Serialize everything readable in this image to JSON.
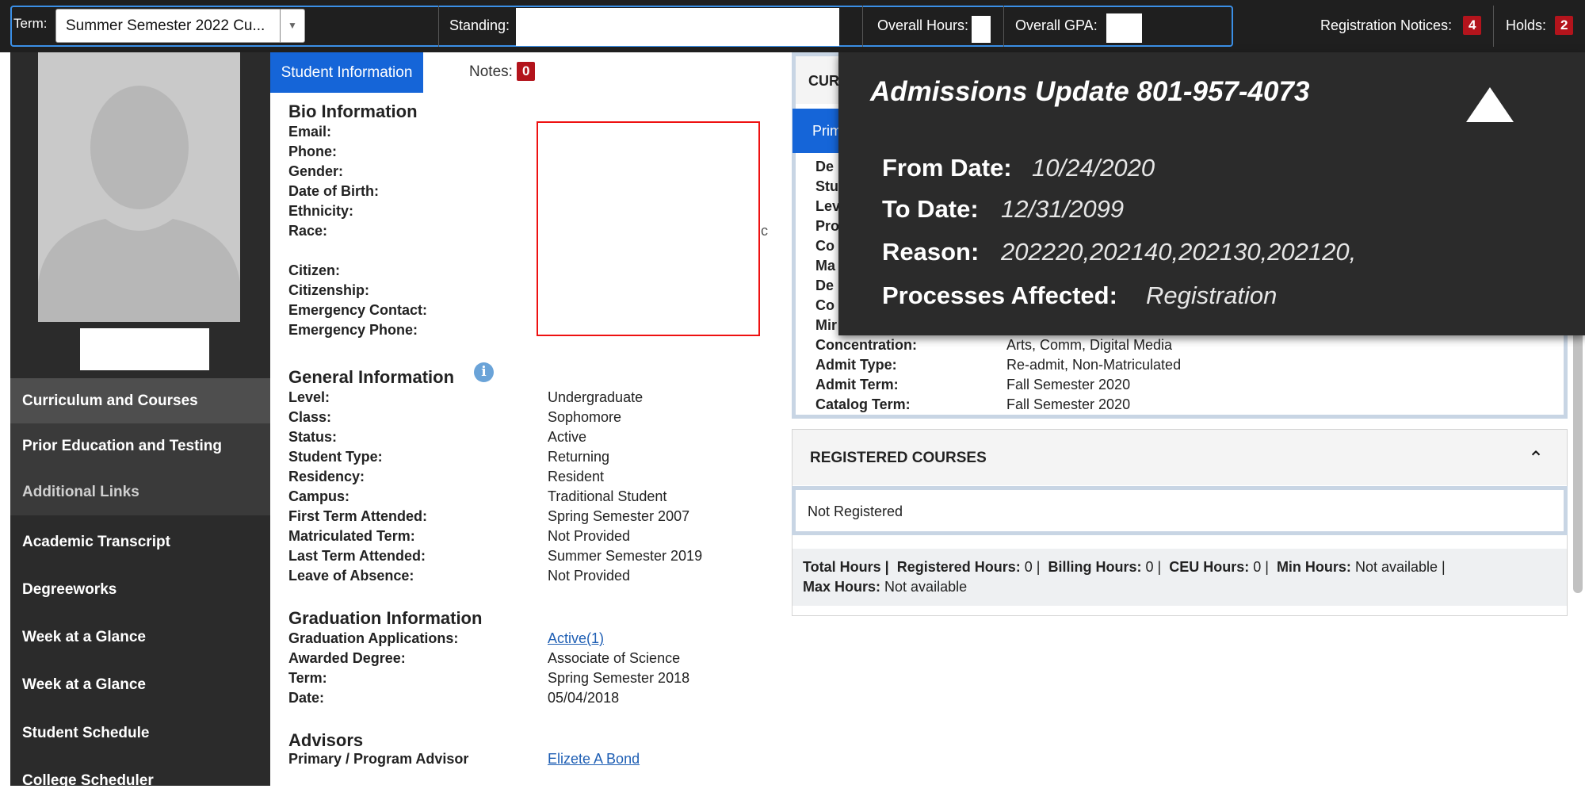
{
  "topbar": {
    "term_label": "Term:",
    "term_value": "Summer Semester 2022 Cu...",
    "standing_label": "Standing:",
    "overall_hours_label": "Overall Hours:",
    "overall_gpa_label": "Overall GPA:",
    "registration_notices_label": "Registration Notices:",
    "registration_notices_count": "4",
    "holds_label": "Holds:",
    "holds_count": "2"
  },
  "sidebar": {
    "items": [
      {
        "label": "Curriculum and Courses"
      },
      {
        "label": "Prior Education and Testing"
      },
      {
        "label": "Additional Links"
      },
      {
        "label": "Academic Transcript"
      },
      {
        "label": "Degreeworks"
      },
      {
        "label": "Week at a Glance"
      },
      {
        "label": "Week at a Glance"
      },
      {
        "label": "Student Schedule"
      },
      {
        "label": "College Scheduler"
      }
    ]
  },
  "center": {
    "tabs": {
      "student_info": "Student Information",
      "notes": "Notes:",
      "notes_count": "0"
    },
    "bio": {
      "heading": "Bio Information",
      "labels": [
        "Email:",
        "Phone:",
        "Gender:",
        "Date of Birth:",
        "Ethnicity:",
        "Race:",
        "Citizen:",
        "Citizenship:",
        "Emergency Contact:",
        "Emergency Phone:"
      ],
      "stray_char": "c"
    },
    "general": {
      "heading": "General Information",
      "info_glyph": "i",
      "rows": [
        {
          "label": "Level:",
          "value": "Undergraduate"
        },
        {
          "label": "Class:",
          "value": "Sophomore"
        },
        {
          "label": "Status:",
          "value": "Active"
        },
        {
          "label": "Student Type:",
          "value": "Returning"
        },
        {
          "label": "Residency:",
          "value": "Resident"
        },
        {
          "label": "Campus:",
          "value": "Traditional Student"
        },
        {
          "label": "First Term Attended:",
          "value": "Spring Semester 2007"
        },
        {
          "label": "Matriculated Term:",
          "value": "Not Provided"
        },
        {
          "label": "Last Term Attended:",
          "value": "Summer Semester 2019"
        },
        {
          "label": "Leave of Absence:",
          "value": "Not Provided"
        }
      ]
    },
    "graduation": {
      "heading": "Graduation Information",
      "rows": [
        {
          "label": "Graduation Applications:",
          "value": "Active(1)"
        },
        {
          "label": "Awarded Degree:",
          "value": "Associate of Science"
        },
        {
          "label": "Term:",
          "value": "Spring Semester 2018"
        },
        {
          "label": "Date:",
          "value": "05/04/2018"
        }
      ]
    },
    "advisors": {
      "heading": "Advisors",
      "label": "Primary / Program Advisor",
      "value": "Elizete A Bond"
    }
  },
  "curriculum": {
    "title_partial": "CUR",
    "primary_tab_partial": "Prim",
    "obscured_label_stubs": [
      "De",
      "Stu",
      "Lev",
      "Pro",
      "Co",
      "Ma",
      "De",
      "Co",
      "Mir"
    ],
    "rows": [
      {
        "label": "Concentration:",
        "value": "Arts, Comm, Digital Media"
      },
      {
        "label": "Admit Type:",
        "value": "Re-admit, Non-Matriculated"
      },
      {
        "label": "Admit Term:",
        "value": "Fall Semester 2020"
      },
      {
        "label": "Catalog Term:",
        "value": "Fall Semester 2020"
      }
    ]
  },
  "registered": {
    "title": "REGISTERED COURSES",
    "chevron": "⌃",
    "status": "Not Registered",
    "summary": {
      "total": "Total Hours |",
      "registered_label": "Registered Hours:",
      "registered_value": "0",
      "billing_label": "Billing Hours:",
      "billing_value": "0",
      "ceu_label": "CEU Hours:",
      "ceu_value": "0",
      "min_label": "Min Hours:",
      "min_value": "Not available",
      "max_label": "Max Hours:",
      "max_value": "Not available"
    }
  },
  "popup": {
    "title": "Admissions Update 801-957-4073",
    "from_label": "From Date:",
    "from_value": "10/24/2020",
    "to_label": "To Date:",
    "to_value": "12/31/2099",
    "reason_label": "Reason:",
    "reason_value": "202220,202140,202130,202120,",
    "processes_label": "Processes Affected:",
    "processes_value": "Registration"
  }
}
